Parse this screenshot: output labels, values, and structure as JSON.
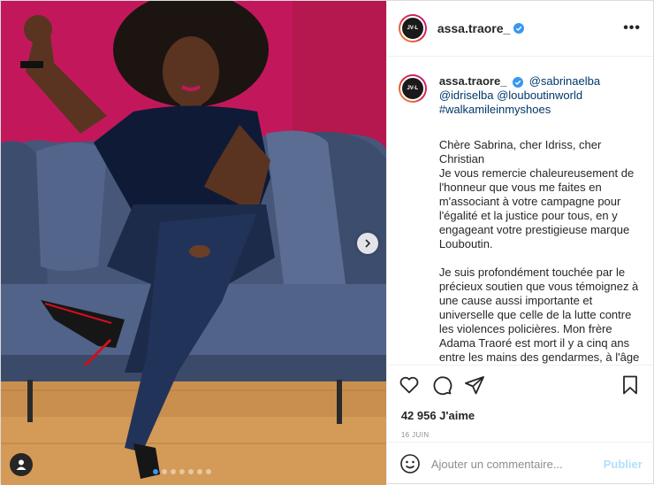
{
  "post": {
    "author": "assa.traore_",
    "avatar_text": "JV-L",
    "more_label": "•••",
    "verified": true
  },
  "caption": {
    "author": "assa.traore_",
    "mentions": [
      "@sabrinaelba",
      "@idriselba",
      "@louboutinworld"
    ],
    "hashtag": "#walkamileinmyshoes",
    "paragraphs": [
      "Chère Sabrina, cher Idriss, cher Christian\nJe vous remercie chaleureusement de l'honneur que vous me faites en m'associant à votre campagne pour l'égalité et la justice pour tous, en y engageant votre prestigieuse marque Louboutin.",
      "Je suis profondément touchée par le précieux soutien que vous témoignez à une cause aussi importante et universelle que celle de la lutte contre les violences policières. Mon frère Adama Traoré est mort il y a cinq ans entre les mains des gendarmes, à l'âge"
    ]
  },
  "engagement": {
    "likes": "42 956 J'aime",
    "date": "16 juin"
  },
  "comment": {
    "placeholder": "Ajouter un commentaire...",
    "publish_label": "Publier"
  },
  "carousel": {
    "slide_count": 7,
    "active_index": 0
  },
  "colors": {
    "accent": "#3897f0",
    "link": "#00376b",
    "publish_disabled": "#b2dffc",
    "wall": "#c2185b",
    "sofa": "#4a5a78"
  }
}
